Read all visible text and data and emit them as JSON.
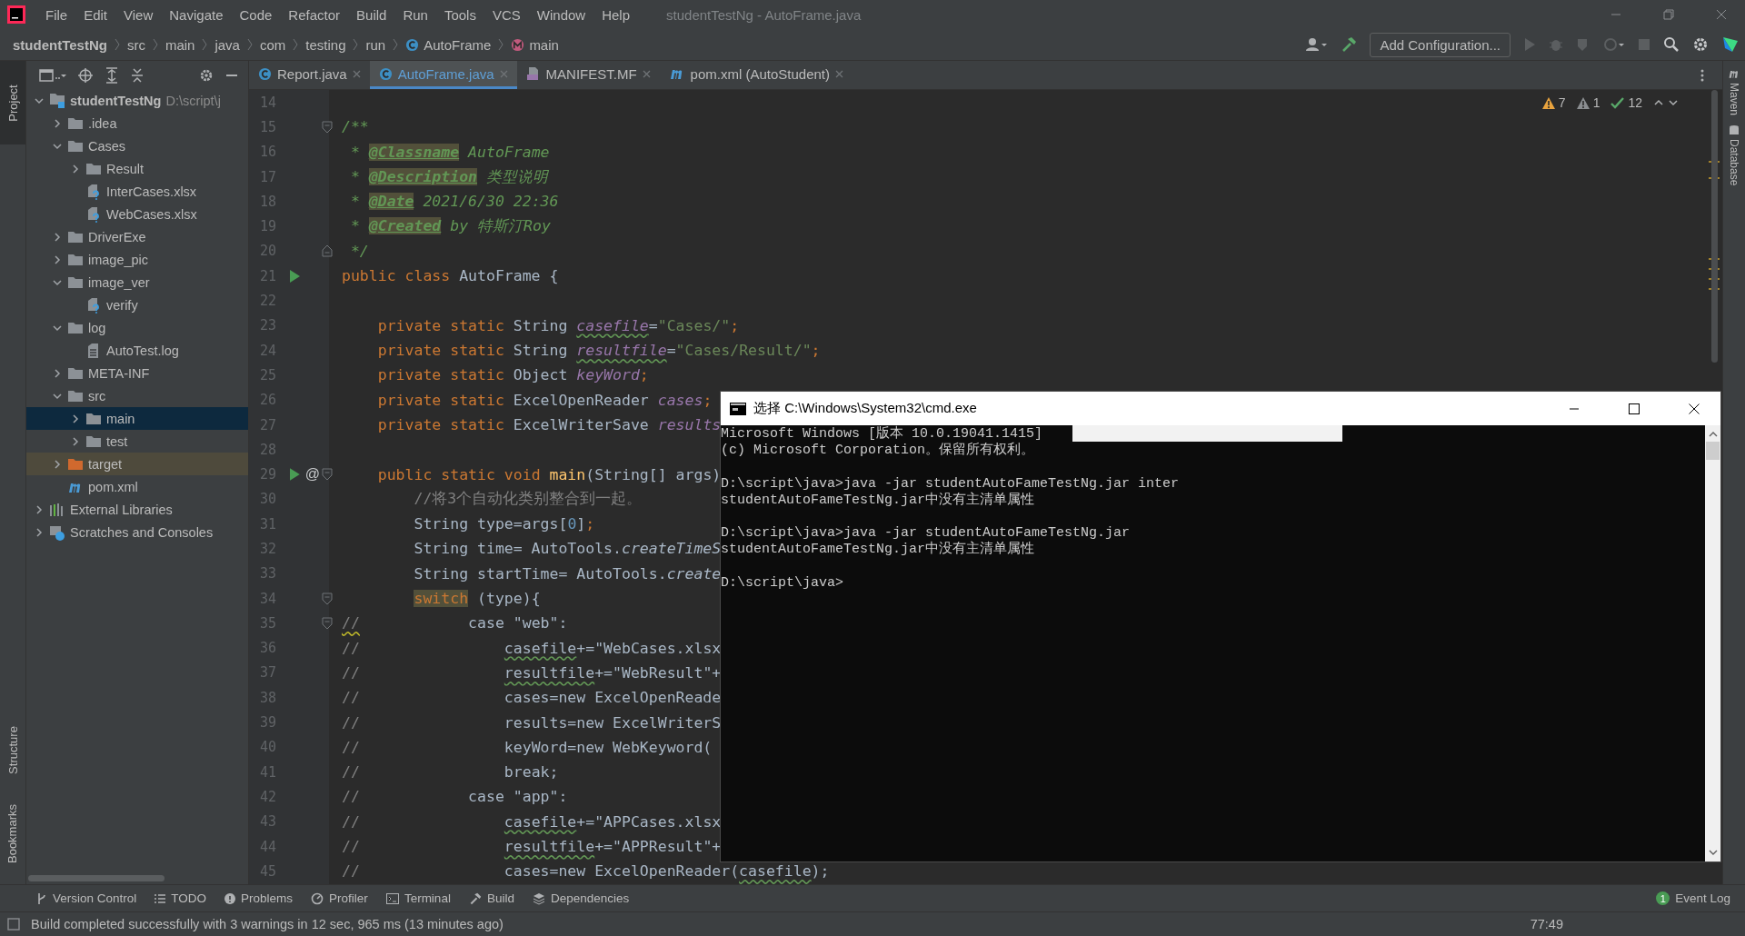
{
  "window": {
    "title": "studentTestNg - AutoFrame.java"
  },
  "menu": [
    "File",
    "Edit",
    "View",
    "Navigate",
    "Code",
    "Refactor",
    "Build",
    "Run",
    "Tools",
    "VCS",
    "Window",
    "Help"
  ],
  "breadcrumbs": [
    {
      "label": "studentTestNg",
      "kind": "plain"
    },
    {
      "label": "src",
      "kind": "plain"
    },
    {
      "label": "main",
      "kind": "plain"
    },
    {
      "label": "java",
      "kind": "plain"
    },
    {
      "label": "com",
      "kind": "plain"
    },
    {
      "label": "testing",
      "kind": "plain"
    },
    {
      "label": "run",
      "kind": "plain"
    },
    {
      "label": "AutoFrame",
      "kind": "class"
    },
    {
      "label": "main",
      "kind": "method"
    }
  ],
  "run_config": {
    "label": "Add Configuration..."
  },
  "left_strip": [
    {
      "label": "Project",
      "selected": true
    },
    {
      "label": "Structure",
      "selected": false
    },
    {
      "label": "Bookmarks",
      "selected": false
    }
  ],
  "right_strip": [
    {
      "label": "Maven"
    },
    {
      "label": "Database"
    }
  ],
  "project_tree": [
    {
      "name": "studentTestNg",
      "path": "D:\\script\\j",
      "kind": "module",
      "expanded": true,
      "selected": false,
      "children": [
        {
          "name": ".idea",
          "kind": "folder",
          "expanded": false,
          "selected": false
        },
        {
          "name": "Cases",
          "kind": "folder",
          "expanded": true,
          "selected": false,
          "children": [
            {
              "name": "Result",
              "kind": "folder",
              "expanded": false,
              "selected": false
            },
            {
              "name": "InterCases.xlsx",
              "kind": "unknown",
              "selected": false
            },
            {
              "name": "WebCases.xlsx",
              "kind": "unknown",
              "selected": false
            }
          ]
        },
        {
          "name": "DriverExe",
          "kind": "folder",
          "expanded": false,
          "selected": false
        },
        {
          "name": "image_pic",
          "kind": "folder",
          "expanded": false,
          "selected": false
        },
        {
          "name": "image_ver",
          "kind": "folder",
          "expanded": true,
          "selected": false,
          "children": [
            {
              "name": "verify",
              "kind": "unknown",
              "selected": false
            }
          ]
        },
        {
          "name": "log",
          "kind": "folder",
          "expanded": true,
          "selected": false,
          "children": [
            {
              "name": "AutoTest.log",
              "kind": "text",
              "selected": false
            }
          ]
        },
        {
          "name": "META-INF",
          "kind": "folder",
          "expanded": false,
          "selected": false
        },
        {
          "name": "src",
          "kind": "folder",
          "expanded": true,
          "selected": false,
          "children": [
            {
              "name": "main",
              "kind": "folder",
              "expanded": false,
              "selected": true
            },
            {
              "name": "test",
              "kind": "folder",
              "expanded": false,
              "selected": false
            }
          ]
        },
        {
          "name": "target",
          "kind": "excluded",
          "expanded": false,
          "selected": false
        },
        {
          "name": "pom.xml",
          "kind": "maven",
          "selected": false
        }
      ]
    },
    {
      "name": "External Libraries",
      "kind": "libraries",
      "expanded": false,
      "selected": false
    },
    {
      "name": "Scratches and Consoles",
      "kind": "scratches",
      "expanded": false,
      "selected": false
    }
  ],
  "tabs": [
    {
      "label": "Report.java",
      "kind": "class",
      "selected": false
    },
    {
      "label": "AutoFrame.java",
      "kind": "class",
      "selected": true
    },
    {
      "label": "MANIFEST.MF",
      "kind": "manifest",
      "selected": false
    },
    {
      "label": "pom.xml (AutoStudent)",
      "kind": "maven",
      "selected": false
    }
  ],
  "inspections": [
    {
      "kind": "warning",
      "count": "7"
    },
    {
      "kind": "weak",
      "count": "1"
    },
    {
      "kind": "ok",
      "count": "12"
    }
  ],
  "code": [
    {
      "number": "14",
      "kind": "line"
    },
    {
      "number": "15",
      "kind": "fold_start",
      "tokens": [
        {
          "kind": "doc",
          "text": "/**"
        }
      ]
    },
    {
      "number": "16",
      "kind": "line",
      "tokens": [
        {
          "kind": "doc",
          "text": " * "
        },
        {
          "kind": "doctag",
          "text": "@Classname"
        },
        {
          "kind": "doc",
          "text": " AutoFrame"
        }
      ]
    },
    {
      "number": "17",
      "kind": "line",
      "tokens": [
        {
          "kind": "doc",
          "text": " * "
        },
        {
          "kind": "doctag",
          "text": "@Description"
        },
        {
          "kind": "doc",
          "text": " 类型说明"
        }
      ]
    },
    {
      "number": "18",
      "kind": "line",
      "tokens": [
        {
          "kind": "doc",
          "text": " * "
        },
        {
          "kind": "doctag",
          "text": "@Date"
        },
        {
          "kind": "doc",
          "text": " 2021/6/30 22:36"
        }
      ]
    },
    {
      "number": "19",
      "kind": "line",
      "tokens": [
        {
          "kind": "doc",
          "text": " * "
        },
        {
          "kind": "doctag",
          "text": "@Created"
        },
        {
          "kind": "doc",
          "text": " by 特斯汀Roy"
        }
      ]
    },
    {
      "number": "20",
      "kind": "fold_end",
      "tokens": [
        {
          "kind": "doc",
          "text": " */"
        }
      ]
    },
    {
      "number": "21",
      "kind": "line",
      "run": true,
      "tokens": [
        {
          "kind": "keyword",
          "text": "public class "
        },
        {
          "kind": "plain",
          "text": "AutoFrame {"
        }
      ]
    },
    {
      "number": "22",
      "kind": "line"
    },
    {
      "number": "23",
      "kind": "line",
      "tokens": [
        {
          "kind": "keyword",
          "text": "    private static "
        },
        {
          "kind": "plain",
          "text": "String "
        },
        {
          "kind": "field_typo",
          "text": "casefile"
        },
        {
          "kind": "plain",
          "text": "="
        },
        {
          "kind": "string",
          "text": "\"Cases/\""
        },
        {
          "kind": "keyword",
          "text": ";"
        }
      ]
    },
    {
      "number": "24",
      "kind": "line",
      "tokens": [
        {
          "kind": "keyword",
          "text": "    private static "
        },
        {
          "kind": "plain",
          "text": "String "
        },
        {
          "kind": "field_typo",
          "text": "resultfile"
        },
        {
          "kind": "plain",
          "text": "="
        },
        {
          "kind": "string",
          "text": "\"Cases/Result/\""
        },
        {
          "kind": "keyword",
          "text": ";"
        }
      ]
    },
    {
      "number": "25",
      "kind": "line",
      "tokens": [
        {
          "kind": "keyword",
          "text": "    private static "
        },
        {
          "kind": "plain",
          "text": "Object "
        },
        {
          "kind": "field",
          "text": "keyWord"
        },
        {
          "kind": "keyword",
          "text": ";"
        }
      ]
    },
    {
      "number": "26",
      "kind": "line",
      "tokens": [
        {
          "kind": "keyword",
          "text": "    private static "
        },
        {
          "kind": "plain",
          "text": "ExcelOpenReader "
        },
        {
          "kind": "field",
          "text": "cases"
        },
        {
          "kind": "keyword",
          "text": ";"
        }
      ]
    },
    {
      "number": "27",
      "kind": "line",
      "tokens": [
        {
          "kind": "keyword",
          "text": "    private static "
        },
        {
          "kind": "plain",
          "text": "ExcelWriterSave "
        },
        {
          "kind": "field",
          "text": "results"
        }
      ]
    },
    {
      "number": "28",
      "kind": "line"
    },
    {
      "number": "29",
      "kind": "fold_start",
      "run": true,
      "badge": "@",
      "tokens": [
        {
          "kind": "keyword",
          "text": "    public static void "
        },
        {
          "kind": "method",
          "text": "main"
        },
        {
          "kind": "plain",
          "text": "(String[] args)"
        }
      ]
    },
    {
      "number": "30",
      "kind": "line",
      "tokens": [
        {
          "kind": "comment",
          "text": "        //将3个自动化类别整合到一起。"
        }
      ]
    },
    {
      "number": "31",
      "kind": "line",
      "tokens": [
        {
          "kind": "plain",
          "text": "        String type=args["
        },
        {
          "kind": "number",
          "text": "0"
        },
        {
          "kind": "plain",
          "text": "]"
        },
        {
          "kind": "keyword",
          "text": ";"
        }
      ]
    },
    {
      "number": "32",
      "kind": "line",
      "tokens": [
        {
          "kind": "plain",
          "text": "        String time= AutoTools."
        },
        {
          "kind": "static",
          "text": "createTimeS"
        }
      ]
    },
    {
      "number": "33",
      "kind": "line",
      "tokens": [
        {
          "kind": "plain",
          "text": "        String startTime= AutoTools."
        },
        {
          "kind": "static",
          "text": "create"
        }
      ]
    },
    {
      "number": "34",
      "kind": "fold_start",
      "tokens": [
        {
          "kind": "keyword_hl",
          "text": "        switch"
        },
        {
          "kind": "plain",
          "text": " (type){"
        }
      ]
    },
    {
      "number": "35",
      "kind": "fold_start",
      "tokens": [
        {
          "kind": "comment_typo",
          "text": "//"
        },
        {
          "kind": "plain",
          "text": "            case \"web\":"
        }
      ]
    },
    {
      "number": "36",
      "kind": "line",
      "tokens": [
        {
          "kind": "comment",
          "text": "//"
        },
        {
          "kind": "typo",
          "text": "                casefile"
        },
        {
          "kind": "plain",
          "text": "+=\"WebCases.xlsx"
        }
      ]
    },
    {
      "number": "37",
      "kind": "line",
      "tokens": [
        {
          "kind": "comment",
          "text": "//"
        },
        {
          "kind": "typo",
          "text": "                resultfile"
        },
        {
          "kind": "plain",
          "text": "+=\"WebResult\"+"
        }
      ]
    },
    {
      "number": "38",
      "kind": "line",
      "tokens": [
        {
          "kind": "comment",
          "text": "//"
        },
        {
          "kind": "plain",
          "text": "                cases=new ExcelOpenReade"
        }
      ]
    },
    {
      "number": "39",
      "kind": "line",
      "tokens": [
        {
          "kind": "comment",
          "text": "//"
        },
        {
          "kind": "plain",
          "text": "                results=new ExcelWriterS"
        }
      ]
    },
    {
      "number": "40",
      "kind": "line",
      "tokens": [
        {
          "kind": "comment",
          "text": "//"
        },
        {
          "kind": "plain",
          "text": "                keyWord=new WebKeyword("
        }
      ]
    },
    {
      "number": "41",
      "kind": "line",
      "tokens": [
        {
          "kind": "comment",
          "text": "//"
        },
        {
          "kind": "plain",
          "text": "                break;"
        }
      ]
    },
    {
      "number": "42",
      "kind": "line",
      "tokens": [
        {
          "kind": "comment",
          "text": "//"
        },
        {
          "kind": "plain",
          "text": "            case \"app\":"
        }
      ]
    },
    {
      "number": "43",
      "kind": "line",
      "tokens": [
        {
          "kind": "comment",
          "text": "//"
        },
        {
          "kind": "typo",
          "text": "                casefile"
        },
        {
          "kind": "plain",
          "text": "+=\"APPCases.xlsx"
        }
      ]
    },
    {
      "number": "44",
      "kind": "line",
      "tokens": [
        {
          "kind": "comment",
          "text": "//"
        },
        {
          "kind": "typo",
          "text": "                resultfile"
        },
        {
          "kind": "plain",
          "text": "+=\"APPResult\"+"
        }
      ]
    },
    {
      "number": "45",
      "kind": "line",
      "tokens": [
        {
          "kind": "comment",
          "text": "//"
        },
        {
          "kind": "plain",
          "text": "                cases=new ExcelOpenReader("
        },
        {
          "kind": "typo",
          "text": "casefile"
        },
        {
          "kind": "plain",
          "text": ");"
        }
      ]
    }
  ],
  "console": {
    "title": "选择 C:\\Windows\\System32\\cmd.exe",
    "blocks": [
      [
        "Microsoft Windows [版本 10.0.19041.1415]",
        "(c) Microsoft Corporation。保留所有权利。"
      ],
      [
        "D:\\script\\java>java -jar studentAutoFameTestNg.jar inter",
        "studentAutoFameTestNg.jar中没有主清单属性"
      ],
      [
        "D:\\script\\java>java -jar studentAutoFameTestNg.jar",
        "studentAutoFameTestNg.jar中没有主清单属性"
      ],
      [
        "D:\\script\\java>"
      ]
    ]
  },
  "tool_windows": [
    {
      "label": "Version Control",
      "kind": "branch"
    },
    {
      "label": "TODO",
      "kind": "list"
    },
    {
      "label": "Problems",
      "kind": "info"
    },
    {
      "label": "Profiler",
      "kind": "gauge"
    },
    {
      "label": "Terminal",
      "kind": "terminal"
    },
    {
      "label": "Build",
      "kind": "hammer"
    },
    {
      "label": "Dependencies",
      "kind": "layers"
    }
  ],
  "event_log": {
    "label": "Event Log",
    "count": "1"
  },
  "status_bar": {
    "message": "Build completed successfully with 3 warnings in 12 sec, 965 ms (13 minutes ago)",
    "position": "77:49"
  }
}
